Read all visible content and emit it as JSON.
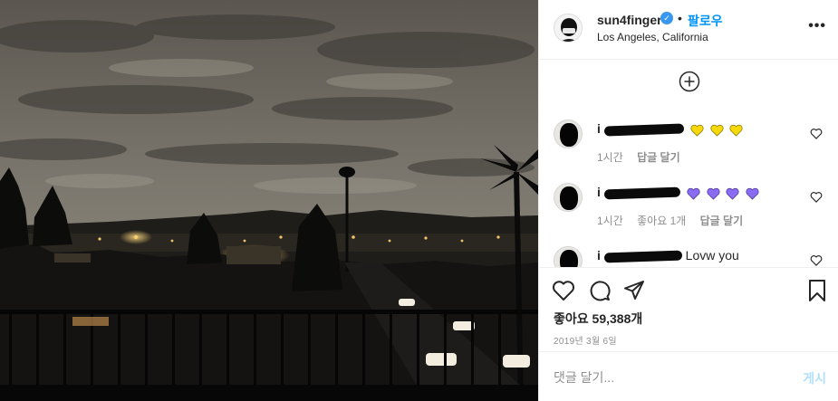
{
  "post": {
    "author": {
      "username": "sun4finger",
      "verified_mark": "✓",
      "separator": "•",
      "follow_label": "팔로우",
      "location": "Los Angeles, California"
    },
    "more_icon": "more-options-icon",
    "load_more_icon": "plus-circle-icon",
    "comments": [
      {
        "username_partial": "i",
        "trailing_text": "",
        "hearts": [
          "#f5d90a",
          "#f5d90a",
          "#f5d90a"
        ],
        "time": "1시간",
        "likes": "",
        "reply_label": "답글 달기"
      },
      {
        "username_partial": "i",
        "trailing_text": "",
        "hearts": [
          "#8a6cf2",
          "#8a6cf2",
          "#8a6cf2",
          "#8a6cf2"
        ],
        "time": "1시간",
        "likes": "좋아요 1개",
        "reply_label": "답글 달기"
      },
      {
        "username_partial": "i",
        "trailing_text": "Lovw you",
        "hearts": [],
        "time": "",
        "likes": "",
        "reply_label": ""
      }
    ],
    "actions": {
      "like_icon": "heart-outline-icon",
      "comment_icon": "comment-icon",
      "share_icon": "share-icon",
      "save_icon": "bookmark-icon"
    },
    "likes_label": "좋아요 59,388개",
    "date": "2019년 3월 6일",
    "add_comment": {
      "placeholder": "댓글 달기...",
      "post_label": "게시"
    }
  },
  "colors": {
    "accent": "#0095f6",
    "verified": "#3897f0",
    "post_disabled": "#b2dffc"
  }
}
